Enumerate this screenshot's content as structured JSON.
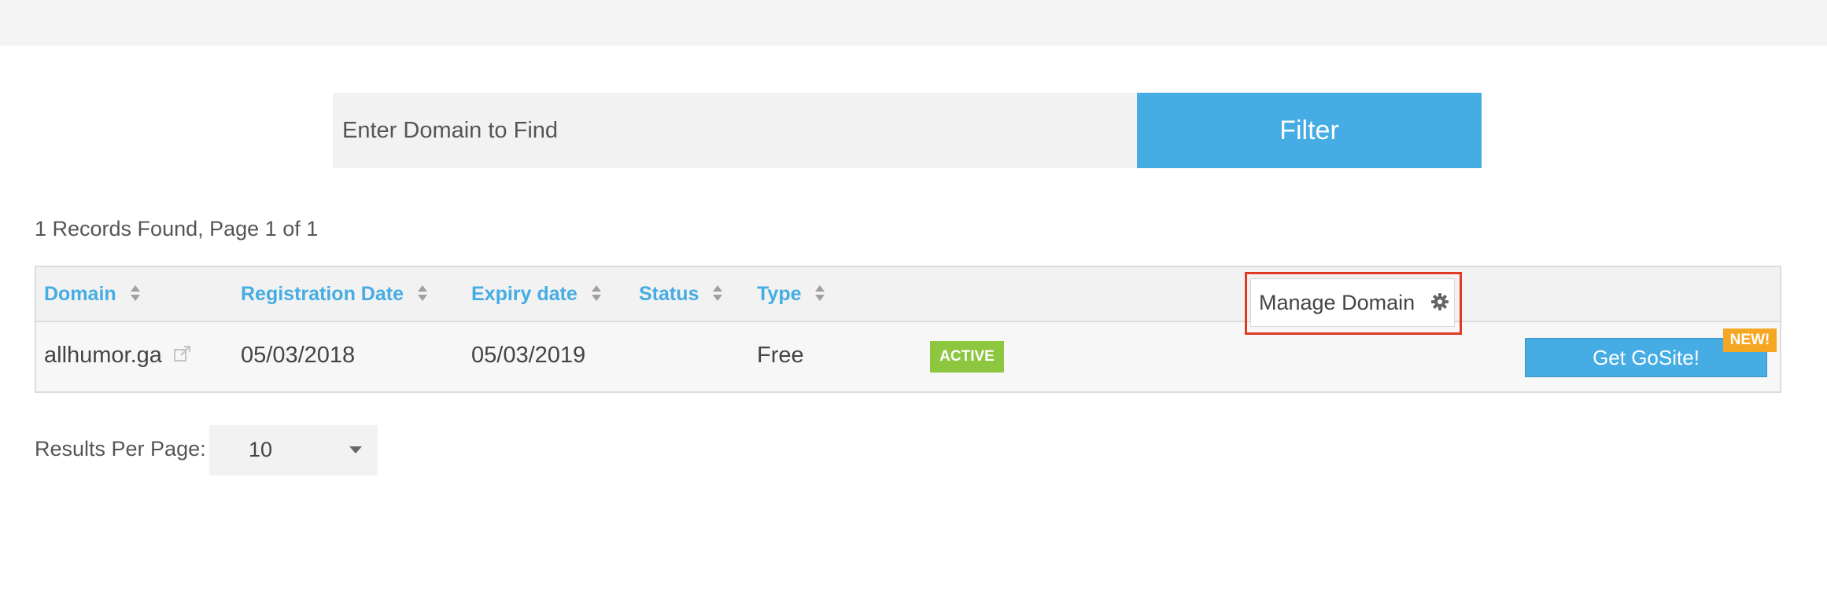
{
  "search": {
    "placeholder": "Enter Domain to Find",
    "value": "",
    "filter_label": "Filter"
  },
  "records_info": "1 Records Found, Page 1 of 1",
  "table": {
    "columns": [
      "Domain",
      "Registration Date",
      "Expiry date",
      "Status",
      "Type"
    ],
    "rows": [
      {
        "domain": "allhumor.ga",
        "registration_date": "05/03/2018",
        "expiry_date": "05/03/2019",
        "status": "ACTIVE",
        "type": "Free",
        "manage_label": "Manage Domain",
        "gosite_label": "Get GoSite!",
        "new_badge": "NEW!"
      }
    ]
  },
  "pagination": {
    "results_per_page_label": "Results Per Page:",
    "results_per_page_value": "10"
  },
  "icons": {
    "sort": "sort-icon",
    "external_link": "external-link-icon",
    "gear": "gear-icon",
    "dropdown": "chevron-down-icon"
  },
  "colors": {
    "accent_blue": "#45ace4",
    "status_active": "#8dc63f",
    "new_badge": "#f5a623",
    "highlight": "#e03a25"
  }
}
